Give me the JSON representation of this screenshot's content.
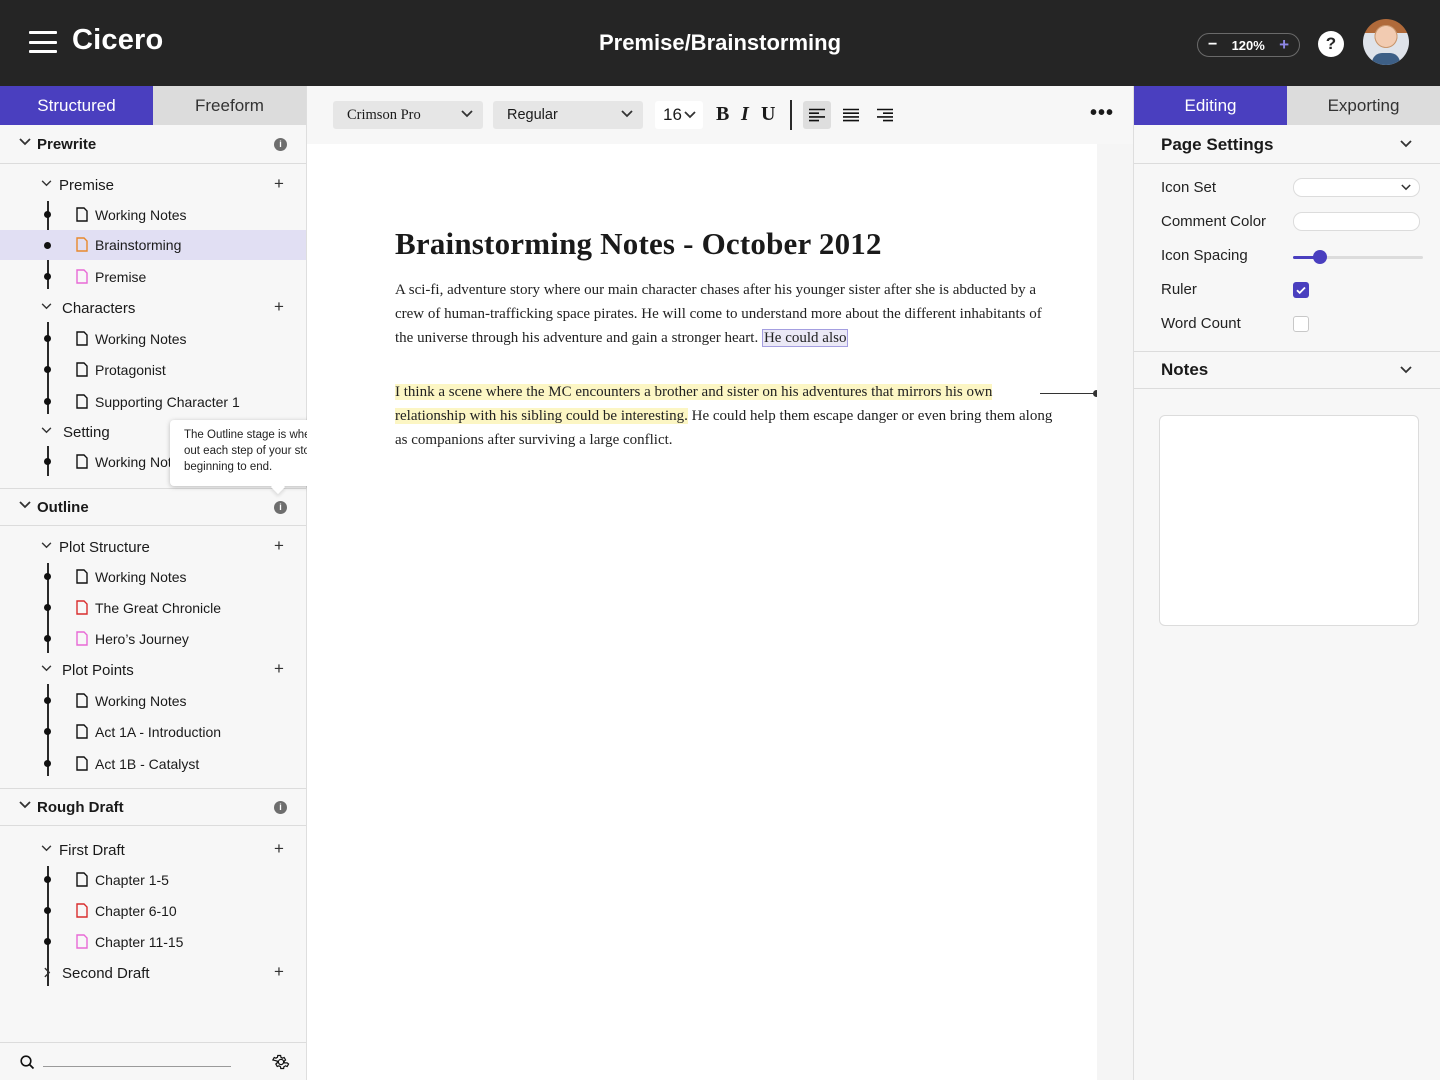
{
  "app": {
    "logo": "Cicero",
    "doc_title": "Premise/Brainstorming",
    "zoom": "120%"
  },
  "left_tabs": [
    "Structured",
    "Freeform"
  ],
  "sections": {
    "prewrite": {
      "label": "Prewrite",
      "groups": {
        "premise": {
          "label": "Premise",
          "items": [
            "Working Notes",
            "Brainstorming",
            "Premise"
          ]
        },
        "characters": {
          "label": "Characters",
          "items": [
            "Working Notes",
            "Protagonist",
            "Supporting Character 1"
          ]
        },
        "setting": {
          "label": "Setting",
          "items": [
            "Working Notes"
          ]
        }
      }
    },
    "outline": {
      "label": "Outline",
      "groups": {
        "plot_structure": {
          "label": "Plot Structure",
          "items": [
            "Working Notes",
            "The Great Chronicle",
            "Hero’s Journey"
          ]
        },
        "plot_points": {
          "label": "Plot Points",
          "items": [
            "Working Notes",
            "Act 1A - Introduction",
            "Act 1B - Catalyst"
          ]
        }
      }
    },
    "rough_draft": {
      "label": "Rough Draft",
      "groups": {
        "first_draft": {
          "label": "First Draft",
          "items": [
            "Chapter 1-5",
            "Chapter 6-10",
            "Chapter 11-15"
          ]
        },
        "second_draft": {
          "label": "Second Draft",
          "items": []
        }
      }
    }
  },
  "tooltip": "The Outline stage is where you lay out each step of your story from beginning to end.",
  "toolbar": {
    "font": "Crimson Pro",
    "weight": "Regular",
    "size": "16",
    "bold": "B",
    "italic": "I",
    "underline": "U"
  },
  "document": {
    "title": "Brainstorming Notes - October 2012",
    "p1_text": "A sci-fi, adventure story where our main character chases after his younger sister after she is abducted by a crew of human-trafficking space pirates. He will come to understand more about the different inhabitants of the universe through his adventure and gain a stronger heart. ",
    "p1_selected": "He could also",
    "p2_highlight": "I think a scene where the MC encounters a brother and sister on his adventures that mirrors his own relationship with his sibling could be interesting.",
    "p2_text": " He could help them escape danger or even bring them along as companions after surviving a large conflict."
  },
  "right_tabs": [
    "Editing",
    "Exporting"
  ],
  "page_settings": {
    "title": "Page Settings",
    "icon_set_label": "Icon Set",
    "comment_color_label": "Comment Color",
    "icon_spacing_label": "Icon Spacing",
    "icon_spacing_value": 0.21,
    "ruler_label": "Ruler",
    "ruler_checked": true,
    "word_count_label": "Word Count",
    "word_count_checked": false
  },
  "notes": {
    "title": "Notes"
  },
  "colors": {
    "accent": "#4a3fbf",
    "topbar": "#252525",
    "doc_orange": "#e8892c",
    "doc_pink": "#e86ad6",
    "doc_red": "#d92d2d",
    "highlight": "#fcf6c4"
  }
}
